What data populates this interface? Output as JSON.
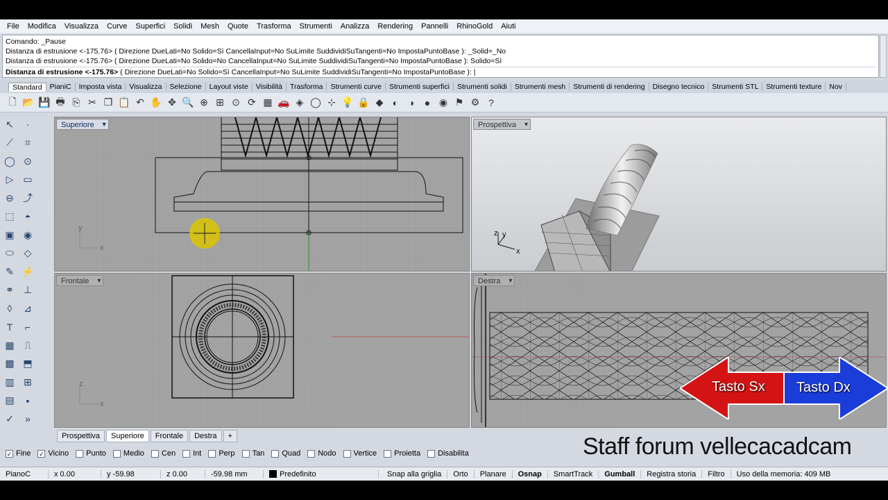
{
  "menu": [
    "File",
    "Modifica",
    "Visualizza",
    "Curve",
    "Superfici",
    "Solidi",
    "Mesh",
    "Quote",
    "Trasforma",
    "Strumenti",
    "Analizza",
    "Rendering",
    "Pannelli",
    "RhinoGold",
    "Aiuti"
  ],
  "command": {
    "line1": "Comando: _Pause",
    "line2": "Distanza di estrusione <-175.76> ( Direzione  DueLati=No  Solido=Sì  CancellaInput=No  SuLimite  SuddividiSuTangenti=No  ImpostaPuntoBase ): _Solid=_No",
    "line3": "Distanza di estrusione <-175.76> ( Direzione  DueLati=No  Solido=No  CancellaInput=No  SuLimite  SuddividiSuTangenti=No  ImpostaPuntoBase ): Solido=Sì",
    "prompt_bold": "Distanza di estrusione <-175.76>",
    "prompt_rest": " ( Direzione  DueLati=No  Solido=Sì  CancellaInput=No  SuLimite  SuddividiSuTangenti=No  ImpostaPuntoBase ): |"
  },
  "tabs": [
    "Standard",
    "PianiC",
    "Imposta vista",
    "Visualizza",
    "Selezione",
    "Layout viste",
    "Visibilità",
    "Trasforma",
    "Strumenti curve",
    "Strumenti superfici",
    "Strumenti solidi",
    "Strumenti mesh",
    "Strumenti di rendering",
    "Disegno tecnico",
    "Strumenti STL",
    "Strumenti texture",
    "Nov"
  ],
  "toolbar_icons": [
    "new-icon",
    "open-icon",
    "save-icon",
    "print-icon",
    "import-icon",
    "cut-icon",
    "copy-icon",
    "paste-icon",
    "undo-icon",
    "pan-icon",
    "move-icon",
    "zoom-icon",
    "zoom-window-icon",
    "zoom-extents-icon",
    "zoom-selected-icon",
    "rotate-view-icon",
    "grid-icon",
    "car-icon",
    "render-icon",
    "circle-icon",
    "snap-icon",
    "light-icon",
    "lock-icon",
    "layer-icon",
    "color-icon",
    "shade-icon",
    "sphere-icon",
    "earth-icon",
    "filter-icon",
    "options-icon",
    "help-icon"
  ],
  "toolbar_glyphs": [
    "🗋",
    "📂",
    "💾",
    "🖶",
    "⎘",
    "✂",
    "❐",
    "📋",
    "↶",
    "✋",
    "✥",
    "🔍",
    "⊕",
    "⊞",
    "⊙",
    "⟳",
    "▦",
    "🚗",
    "◈",
    "◯",
    "⊹",
    "💡",
    "🔒",
    "◆",
    "◐",
    "◑",
    "●",
    "◉",
    "⚑",
    "⚙",
    "?"
  ],
  "viewports": {
    "top": "Superiore",
    "perspective": "Prospettiva",
    "front": "Frontale",
    "right": "Destra"
  },
  "axis": {
    "x": "x",
    "y": "y",
    "z": "z"
  },
  "viewport_tabs": [
    "Prospettiva",
    "Superiore",
    "Frontale",
    "Destra",
    "+"
  ],
  "osnap": [
    {
      "label": "Fine",
      "checked": true
    },
    {
      "label": "Vicino",
      "checked": true
    },
    {
      "label": "Punto",
      "checked": false
    },
    {
      "label": "Medio",
      "checked": false
    },
    {
      "label": "Cen",
      "checked": false
    },
    {
      "label": "Int",
      "checked": false
    },
    {
      "label": "Perp",
      "checked": false
    },
    {
      "label": "Tan",
      "checked": false
    },
    {
      "label": "Quad",
      "checked": false
    },
    {
      "label": "Nodo",
      "checked": false
    },
    {
      "label": "Vertice",
      "checked": false
    },
    {
      "label": "Proietta",
      "checked": false
    },
    {
      "label": "Disabilita",
      "checked": false
    }
  ],
  "status": {
    "cplane": "PianoC",
    "x": "x 0.00",
    "y": "y -59.98",
    "z": "z 0.00",
    "distance": "-59.98 mm",
    "layer": "Predefinito",
    "grid_snap": "Snap alla griglia",
    "ortho": "Orto",
    "planar": "Planare",
    "osnap": "Osnap",
    "smarttrack": "SmartTrack",
    "gumball": "Gumball",
    "history": "Registra storia",
    "filter": "Filtro",
    "memory": "Uso della memoria: 409 MB"
  },
  "overlay": {
    "left_button": "Tasto Sx",
    "right_button": "Tasto Dx",
    "left_color": "#d41414",
    "right_color": "#1a3cd8",
    "watermark": "Staff forum vellecacadcam"
  }
}
